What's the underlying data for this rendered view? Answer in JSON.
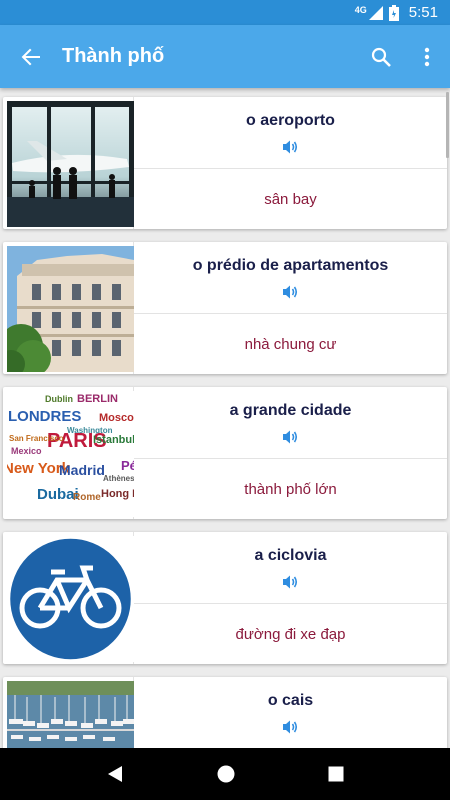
{
  "status_bar": {
    "network": "4G",
    "time": "5:51"
  },
  "app_bar": {
    "title": "Thành phố"
  },
  "icons": {
    "back": "back-arrow-icon",
    "search": "search-icon",
    "more": "more-vert-icon",
    "speaker": "speaker-icon"
  },
  "colors": {
    "status_bar": "#2b8ed6",
    "app_bar": "#4ba8ea",
    "term": "#1a1f4a",
    "translation": "#8b1a3c",
    "speaker": "#2f8de0"
  },
  "cards": [
    {
      "term": "o aeroporto",
      "translation": "sân bay",
      "image": "airport"
    },
    {
      "term": "o prédio de apartamentos",
      "translation": "nhà chung cư",
      "image": "apartment-building"
    },
    {
      "term": "a grande cidade",
      "translation": "thành phố lớn",
      "image": "city-names-word-cloud"
    },
    {
      "term": "a ciclovia",
      "translation": "đường đi xe đạp",
      "image": "bicycle-lane-sign"
    },
    {
      "term": "o cais",
      "translation": "",
      "image": "harbor-boats"
    }
  ],
  "word_cloud": [
    "Dublin",
    "BERLIN",
    "LONDRES",
    "Moscou",
    "PARIS",
    "Washington",
    "New York",
    "Madrid",
    "Pé",
    "Athènes",
    "Dubai",
    "Rome",
    "Hong Ko",
    "Istanbul",
    "Mexico",
    "San Francisco"
  ]
}
